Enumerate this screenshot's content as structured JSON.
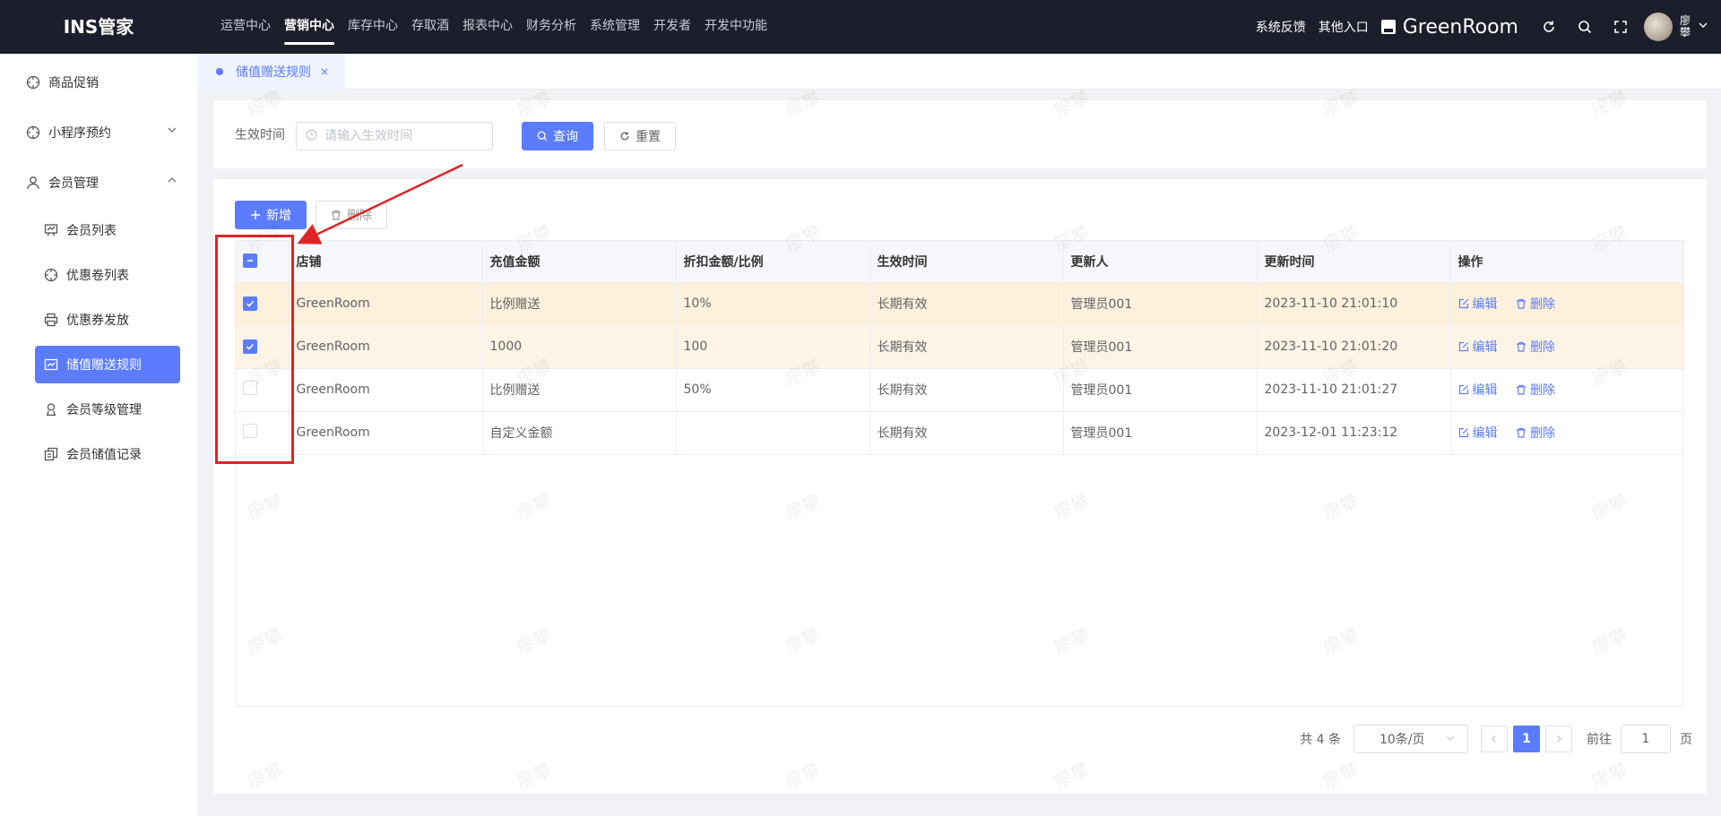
{
  "app": {
    "logo": "INS管家"
  },
  "topnav": [
    {
      "label": "运营中心",
      "active": false
    },
    {
      "label": "营销中心",
      "active": true
    },
    {
      "label": "库存中心",
      "active": false
    },
    {
      "label": "存取酒",
      "active": false
    },
    {
      "label": "报表中心",
      "active": false
    },
    {
      "label": "财务分析",
      "active": false
    },
    {
      "label": "系统管理",
      "active": false
    },
    {
      "label": "开发者",
      "active": false
    },
    {
      "label": "开发中功能",
      "active": false
    }
  ],
  "topright": {
    "feedback": "系统反馈",
    "other_entry": "其他入口",
    "store_name": "GreenRoom",
    "user_name": "廖攀",
    "icons": [
      "refresh-icon",
      "search-icon",
      "fullscreen-icon",
      "chevron-down-icon"
    ]
  },
  "sidebar": {
    "items": [
      {
        "label": "商品促销",
        "icon": "target-icon"
      },
      {
        "label": "小程序预约",
        "icon": "target-icon",
        "expand": "collapsed"
      },
      {
        "label": "会员管理",
        "icon": "user-icon",
        "expand": "expanded"
      }
    ],
    "sub_items": [
      {
        "label": "会员列表",
        "icon": "board-icon"
      },
      {
        "label": "优惠卷列表",
        "icon": "target-icon"
      },
      {
        "label": "优惠券发放",
        "icon": "printer-icon"
      },
      {
        "label": "储值赠送规则",
        "icon": "chart-icon",
        "active": true
      },
      {
        "label": "会员等级管理",
        "icon": "user-badge-icon"
      },
      {
        "label": "会员储值记录",
        "icon": "copy-icon"
      }
    ]
  },
  "tabs": [
    {
      "label": "储值赠送规则",
      "close": "×"
    }
  ],
  "search": {
    "label": "生效时间",
    "placeholder": "请输入生效时间",
    "query_btn": "查询",
    "reset_btn": "重置"
  },
  "toolbar": {
    "add_btn": "新增",
    "delete_btn": "删除"
  },
  "table": {
    "columns": [
      "店铺",
      "充值金额",
      "折扣金额/比例",
      "生效时间",
      "更新人",
      "更新时间",
      "操作"
    ],
    "rows": [
      {
        "checked": true,
        "store": "GreenRoom",
        "amount": "比例赠送",
        "discount": "10%",
        "effective": "长期有效",
        "updater": "管理员001",
        "updated": "2023-11-10 21:01:10"
      },
      {
        "checked": true,
        "store": "GreenRoom",
        "amount": "1000",
        "discount": "100",
        "effective": "长期有效",
        "updater": "管理员001",
        "updated": "2023-11-10 21:01:20"
      },
      {
        "checked": false,
        "store": "GreenRoom",
        "amount": "比例赠送",
        "discount": "50%",
        "effective": "长期有效",
        "updater": "管理员001",
        "updated": "2023-11-10 21:01:27"
      },
      {
        "checked": false,
        "store": "GreenRoom",
        "amount": "自定义金额",
        "discount": "",
        "effective": "长期有效",
        "updater": "管理员001",
        "updated": "2023-12-01 11:23:12"
      }
    ],
    "edit_label": "编辑",
    "delete_label": "删除"
  },
  "pagination": {
    "total": "共 4 条",
    "page_size": "10条/页",
    "current_page": "1",
    "goto_label": "前往",
    "goto_value": "1",
    "page_suffix": "页"
  },
  "watermark": "廖攀",
  "colors": {
    "primary": "#5b7cfd",
    "topbar": "#1c1e2b",
    "selected_row": "#fdf0dc",
    "annotation": "#e02424"
  }
}
